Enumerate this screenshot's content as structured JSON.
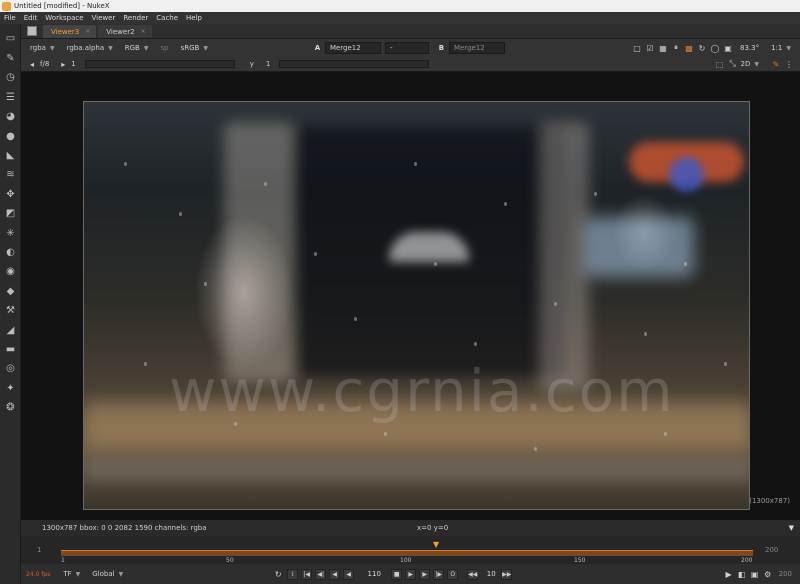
{
  "window": {
    "title": "Untitled [modified] - NukeX"
  },
  "menu": [
    "File",
    "Edit",
    "Workspace",
    "Viewer",
    "Render",
    "Cache",
    "Help"
  ],
  "tabs": [
    {
      "label": "Viewer3",
      "active": true,
      "close": "×"
    },
    {
      "label": "Viewer2",
      "active": false,
      "close": "×"
    }
  ],
  "controls": {
    "layer": "rgba",
    "channel": "rgba.alpha",
    "colorspace": "RGB",
    "lut_icon": "sp",
    "viewer_lut": "sRGB",
    "a_label": "A",
    "a_input": "Merge12",
    "blend_mode": "-",
    "b_label": "B",
    "b_input": "Merge12",
    "zoom": "83.3°",
    "ratio": "1:1",
    "fstop": "f/8",
    "gain_value": "1",
    "y_label": "y",
    "gamma_value": "1",
    "view_mode": "2D"
  },
  "viewer": {
    "watermark": "www.cgrnia.com",
    "resolution_label": "(1300x787)"
  },
  "info": {
    "left": "1300x787   bbox: 0 0 2082 1590 channels: rgba",
    "coords": "x=0 y=0"
  },
  "timeline": {
    "start": "1",
    "end": "200",
    "ticks": [
      "1",
      "50",
      "100",
      "150",
      "200"
    ],
    "in_label": "1",
    "out_label": "200"
  },
  "playback": {
    "fps": "24.0 fps",
    "tf": "TF",
    "scope": "Global",
    "frame": "110",
    "step": "10",
    "end": "200"
  },
  "colors": {
    "accent": "#f0a030",
    "timeline": "#d08030"
  }
}
